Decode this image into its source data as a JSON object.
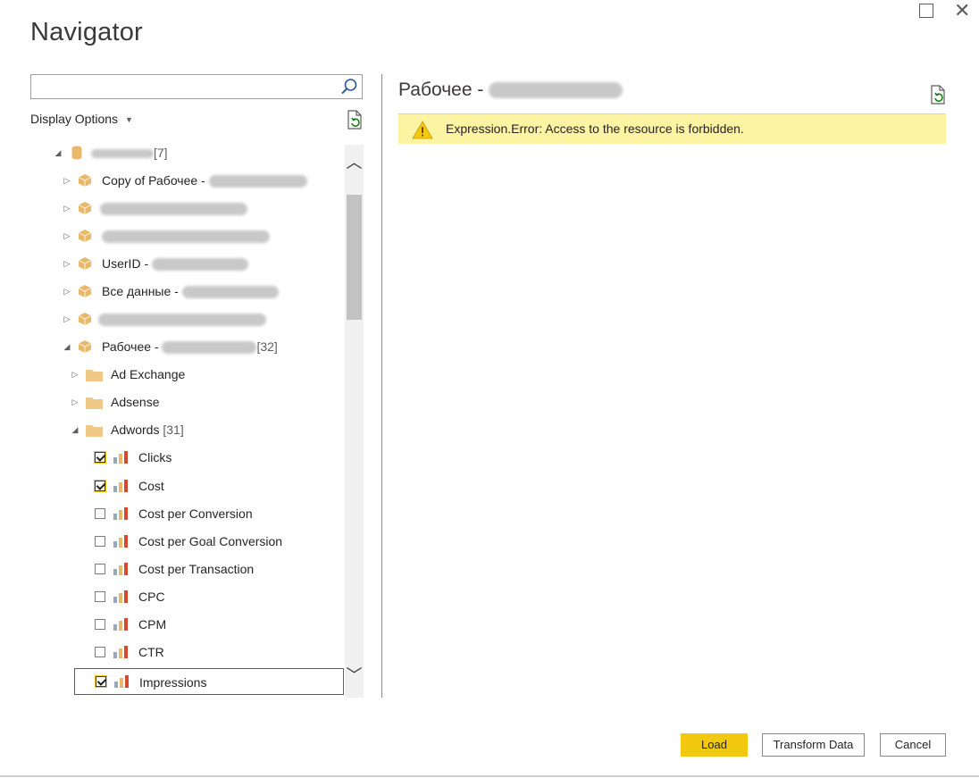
{
  "window": {
    "title": "Navigator",
    "maximize_icon": "maximize-icon",
    "close_icon": "close-icon"
  },
  "search": {
    "value": "",
    "placeholder": ""
  },
  "display_options_label": "Display Options",
  "tree": {
    "root": {
      "count": "[7]"
    },
    "items": [
      {
        "label": "Copy of Рабочее - ",
        "expanded": false
      },
      {
        "label": "",
        "expanded": false
      },
      {
        "label": "",
        "expanded": false
      },
      {
        "label": "UserID - ",
        "expanded": false
      },
      {
        "label": "Все данные - ",
        "expanded": false
      },
      {
        "label": "",
        "expanded": false
      },
      {
        "label": "Рабочее - ",
        "count": "[32]",
        "expanded": true
      }
    ],
    "folders": [
      {
        "label": "Ad Exchange",
        "expanded": false
      },
      {
        "label": "Adsense",
        "expanded": false
      },
      {
        "label": "Adwords",
        "count": "[31]",
        "expanded": true
      }
    ],
    "metrics": [
      {
        "label": "Clicks",
        "checked": true
      },
      {
        "label": "Cost",
        "checked": true
      },
      {
        "label": "Cost per Conversion",
        "checked": false
      },
      {
        "label": "Cost per Goal Conversion",
        "checked": false
      },
      {
        "label": "Cost per Transaction",
        "checked": false
      },
      {
        "label": "CPC",
        "checked": false
      },
      {
        "label": "CPM",
        "checked": false
      },
      {
        "label": "CTR",
        "checked": false
      },
      {
        "label": "Impressions",
        "checked": true,
        "selected": true
      }
    ]
  },
  "preview": {
    "title": "Рабочее - ",
    "error": "Expression.Error: Access to the resource is forbidden."
  },
  "buttons": {
    "load": "Load",
    "transform": "Transform Data",
    "cancel": "Cancel"
  },
  "colors": {
    "accent": "#f2c811",
    "error_bg": "#fcf3a3",
    "cube": "#e8b96a",
    "folder": "#f0c987"
  }
}
